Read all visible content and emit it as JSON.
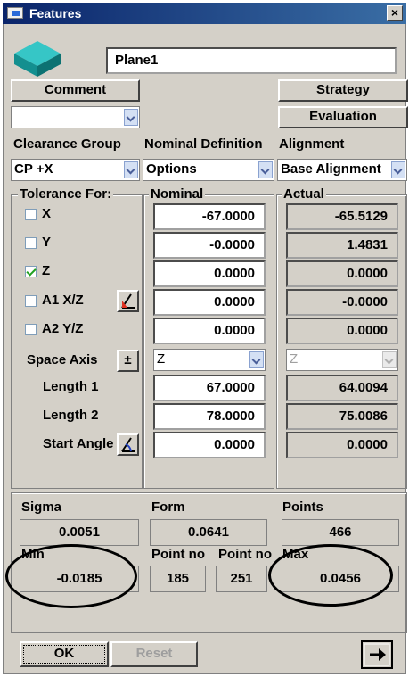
{
  "window": {
    "title": "Features"
  },
  "feature": {
    "name": "Plane1"
  },
  "buttons": {
    "comment": "Comment",
    "strategy": "Strategy",
    "evaluation": "Evaluation",
    "ok": "OK",
    "reset": "Reset"
  },
  "headers": {
    "clearance_group": "Clearance Group",
    "nominal_definition": "Nominal Definition",
    "alignment": "Alignment"
  },
  "selects": {
    "clearance_group": "CP +X",
    "nominal_definition": "Options",
    "alignment": "Base Alignment",
    "space_axis_nominal": "Z",
    "space_axis_actual": "Z"
  },
  "groups": {
    "tolerance_for": "Tolerance For:",
    "nominal": "Nominal",
    "actual": "Actual"
  },
  "rows": [
    {
      "label": "X",
      "checked": false,
      "nominal": "-67.0000",
      "actual": "-65.5129"
    },
    {
      "label": "Y",
      "checked": false,
      "nominal": "-0.0000",
      "actual": "1.4831"
    },
    {
      "label": "Z",
      "checked": true,
      "nominal": "0.0000",
      "actual": "0.0000"
    },
    {
      "label": "A1 X/Z",
      "checked": false,
      "nominal": "0.0000",
      "actual": "-0.0000"
    },
    {
      "label": "A2 Y/Z",
      "checked": false,
      "nominal": "0.0000",
      "actual": "0.0000"
    }
  ],
  "space_axis": {
    "label": "Space Axis",
    "button": "±"
  },
  "length1": {
    "label": "Length 1",
    "nominal": "67.0000",
    "actual": "64.0094"
  },
  "length2": {
    "label": "Length 2",
    "nominal": "78.0000",
    "actual": "75.0086"
  },
  "start_angle": {
    "label": "Start Angle",
    "nominal": "0.0000",
    "actual": "0.0000"
  },
  "stats": {
    "sigma_label": "Sigma",
    "sigma": "0.0051",
    "form_label": "Form",
    "form": "0.0641",
    "points_label": "Points",
    "points": "466",
    "min_label": "Min",
    "min": "-0.0185",
    "point_no_label_1": "Point no",
    "point_no_1": "185",
    "point_no_label_2": "Point no",
    "point_no_2": "251",
    "max_label": "Max",
    "max": "0.0456"
  },
  "icons": {
    "title_icon": "features-window-icon",
    "close": "close-icon",
    "feature_preview": "plane-3d-icon",
    "angle_tool": "angle-tool-icon",
    "next": "arrow-right-icon"
  },
  "colors": {
    "titlebar_start": "#0a246a",
    "titlebar_end": "#3a6ea5",
    "dialog_bg": "#d4d0c8",
    "plane_icon": "#1aa8a8",
    "checkmark": "#21a121"
  }
}
